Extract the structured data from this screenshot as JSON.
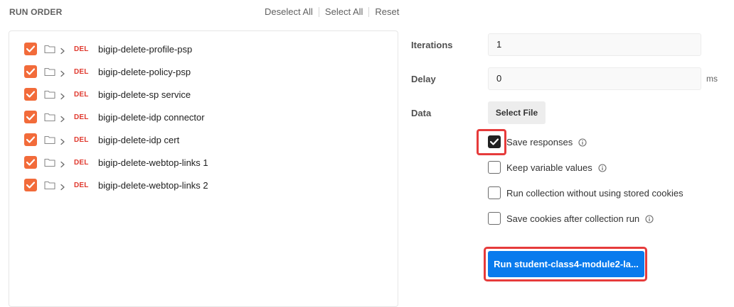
{
  "header": {
    "title": "RUN ORDER",
    "deselect_all": "Deselect All",
    "select_all": "Select All",
    "reset": "Reset"
  },
  "requests": [
    {
      "method": "DEL",
      "name": "bigip-delete-profile-psp",
      "checked": true
    },
    {
      "method": "DEL",
      "name": "bigip-delete-policy-psp",
      "checked": true
    },
    {
      "method": "DEL",
      "name": "bigip-delete-sp service",
      "checked": true
    },
    {
      "method": "DEL",
      "name": "bigip-delete-idp connector",
      "checked": true
    },
    {
      "method": "DEL",
      "name": "bigip-delete-idp cert",
      "checked": true
    },
    {
      "method": "DEL",
      "name": "bigip-delete-webtop-links 1",
      "checked": true
    },
    {
      "method": "DEL",
      "name": "bigip-delete-webtop-links 2",
      "checked": true
    }
  ],
  "settings": {
    "iterations_label": "Iterations",
    "iterations_value": "1",
    "delay_label": "Delay",
    "delay_value": "0",
    "delay_unit": "ms",
    "data_label": "Data",
    "select_file": "Select File"
  },
  "options": [
    {
      "label": "Save responses",
      "checked": true,
      "info": true
    },
    {
      "label": "Keep variable values",
      "checked": false,
      "info": true
    },
    {
      "label": "Run collection without using stored cookies",
      "checked": false,
      "info": false
    },
    {
      "label": "Save cookies after collection run",
      "checked": false,
      "info": true
    }
  ],
  "run_button": "Run student-class4-module2-la...",
  "colors": {
    "checkbox_checked": "#f26b3a",
    "method_delete": "#e03a2f",
    "run_button": "#097bed",
    "highlight": "#e63b3b"
  }
}
